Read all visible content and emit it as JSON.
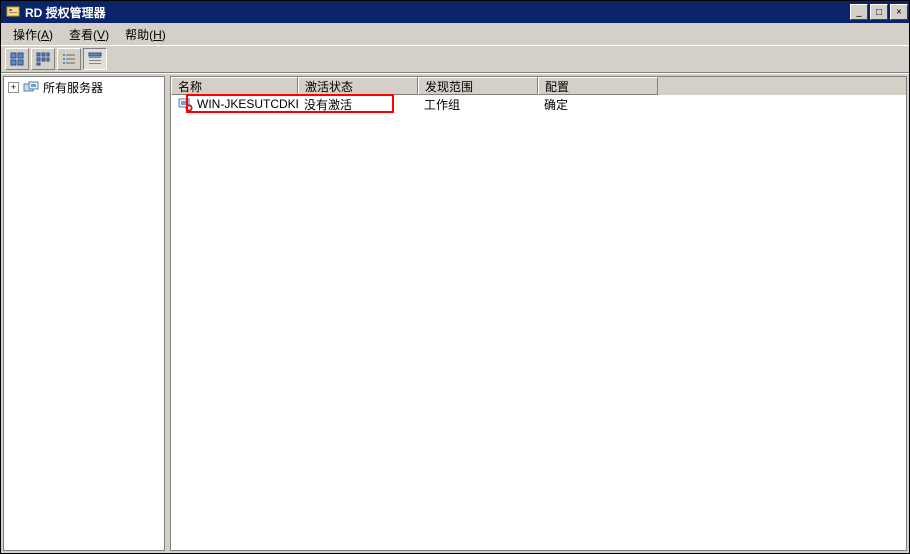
{
  "window": {
    "title": "RD 授权管理器"
  },
  "menubar": {
    "items": [
      {
        "label": "操作",
        "accel": "A"
      },
      {
        "label": "查看",
        "accel": "V"
      },
      {
        "label": "帮助",
        "accel": "H"
      }
    ]
  },
  "tree": {
    "root_label": "所有服务器"
  },
  "list": {
    "columns": {
      "name": "名称",
      "activation": "激活状态",
      "scope": "发现范围",
      "config": "配置"
    },
    "column_widths": {
      "name": 127,
      "activation": 120,
      "scope": 120,
      "config": 120
    },
    "rows": [
      {
        "name": "WIN-JKESUTCDKFE",
        "activation": "没有激活",
        "scope": "工作组",
        "config": "确定"
      }
    ]
  },
  "controls": {
    "min": "_",
    "max": "□",
    "close": "×"
  }
}
